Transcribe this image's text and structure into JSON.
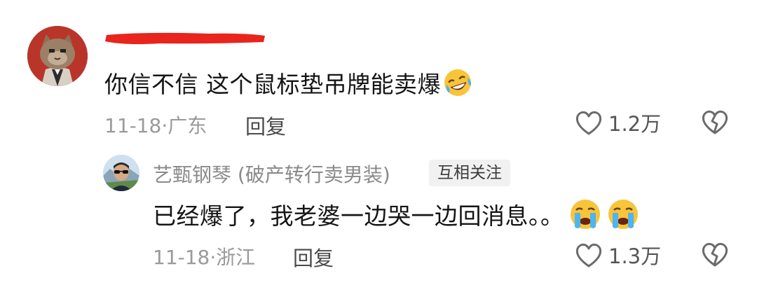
{
  "comments": [
    {
      "author": "",
      "author_redacted": true,
      "avatar": "cat-in-suit-avatar",
      "text": "你信不信 这个鼠标垫吊牌能卖爆",
      "emoji": "laughing-crying-emoji",
      "date": "11-18",
      "location": "广东",
      "reply_label": "回复",
      "likes": "1.2万"
    }
  ],
  "reply": {
    "author": "艺甄钢琴 (破产转行卖男装)",
    "badge": "互相关注",
    "avatar": "man-sunglasses-avatar",
    "text": "已经爆了，我老婆一边哭一边回消息。。",
    "emojis": [
      "crying-emoji",
      "crying-emoji"
    ],
    "date": "11-18",
    "location": "浙江",
    "reply_label": "回复",
    "likes": "1.3万"
  },
  "colors": {
    "redaction": "#e8241c",
    "avatar_bg": "#b9352a",
    "meta": "#9a9a9a",
    "text": "#151515"
  }
}
